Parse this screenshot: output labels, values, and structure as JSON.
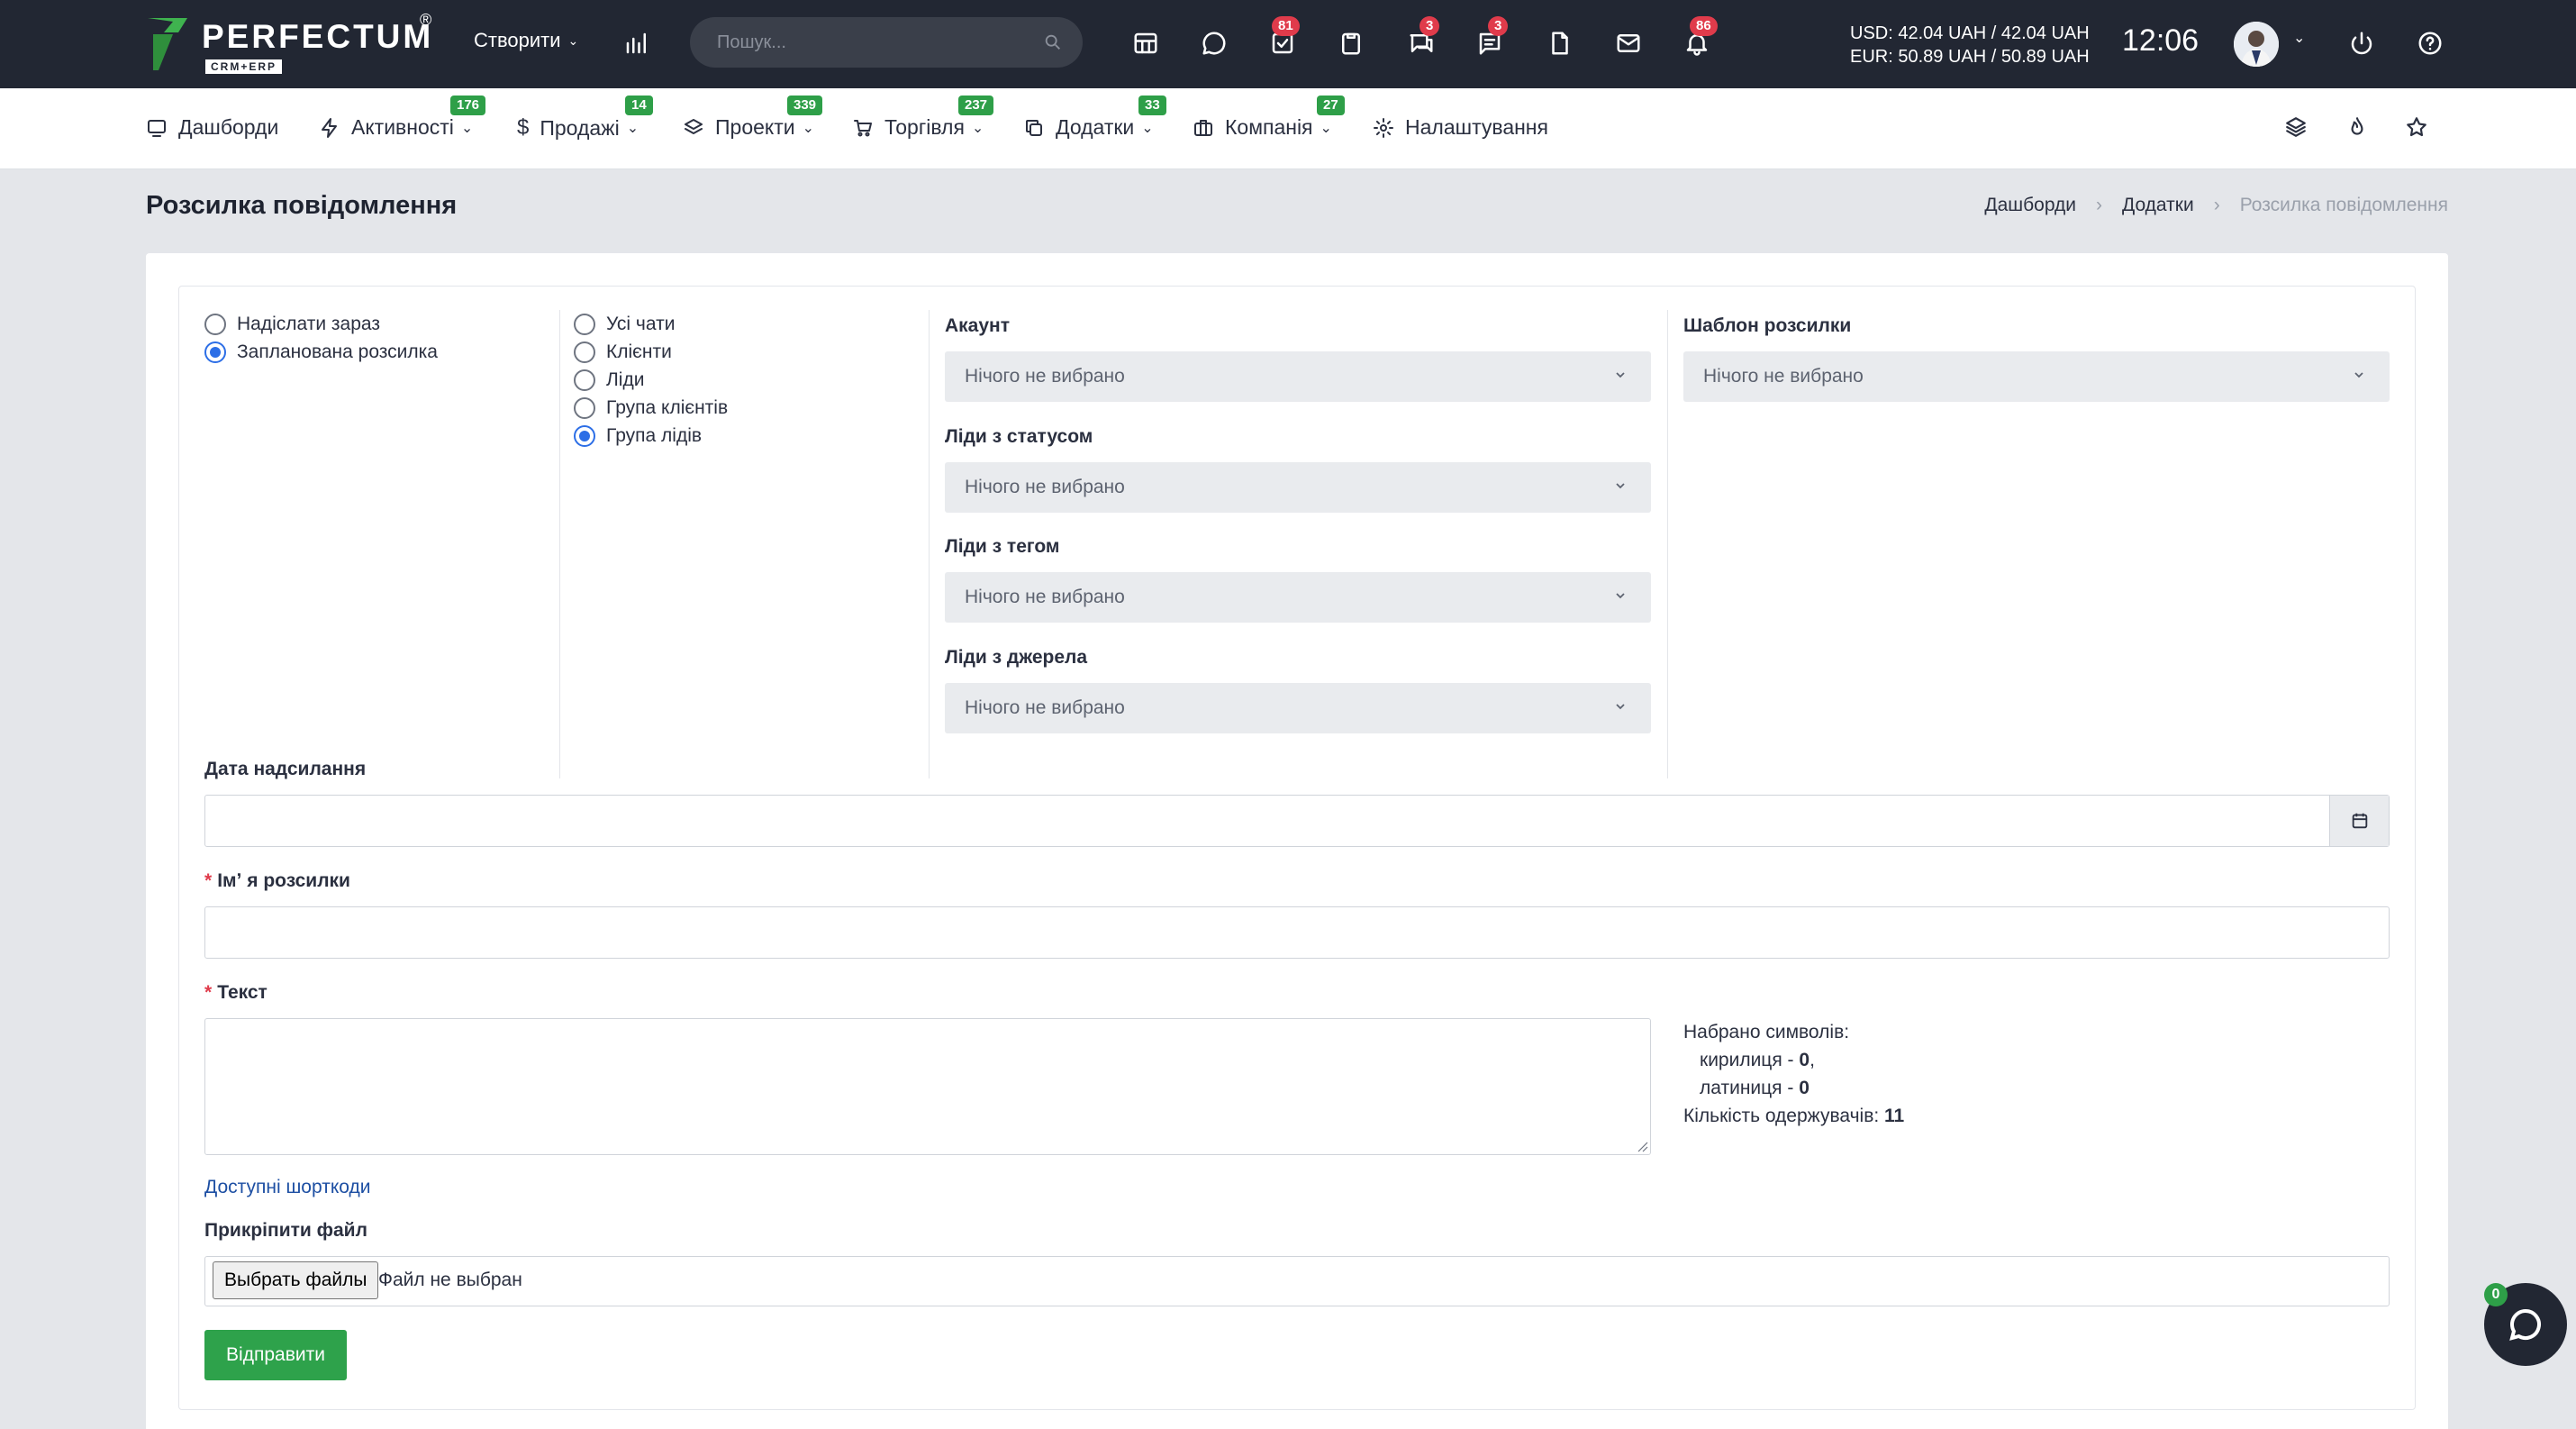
{
  "brand": {
    "name": "PERFECTUM",
    "reg": "®",
    "sub": "CRM+ERP"
  },
  "topbar": {
    "create_label": "Створити",
    "search_placeholder": "Пошук...",
    "badges": {
      "tasks": "81",
      "chat": "3",
      "messages": "3",
      "notifications": "86"
    },
    "currency_usd": "USD: 42.04 UAH / 42.04 UAH",
    "currency_eur": "EUR: 50.89 UAH / 50.89 UAH",
    "time": "12:06"
  },
  "nav": {
    "items": [
      {
        "label": "Дашборди",
        "badge": ""
      },
      {
        "label": "Активності",
        "badge": "176"
      },
      {
        "label": "Продажі",
        "badge": "14"
      },
      {
        "label": "Проекти",
        "badge": "339"
      },
      {
        "label": "Торгівля",
        "badge": "237"
      },
      {
        "label": "Додатки",
        "badge": "33"
      },
      {
        "label": "Компанія",
        "badge": "27"
      },
      {
        "label": "Налаштування",
        "badge": ""
      }
    ]
  },
  "page": {
    "title": "Розсилка повідомлення",
    "breadcrumb": [
      "Дашборди",
      "Додатки",
      "Розсилка повідомлення"
    ]
  },
  "form": {
    "send_mode": [
      "Надіслати зараз",
      "Запланована розсилка"
    ],
    "send_mode_selected": 1,
    "recipients": [
      "Усі чати",
      "Клієнти",
      "Ліди",
      "Група клієнтів",
      "Група лідів"
    ],
    "recipients_selected": 4,
    "account_label": "Акаунт",
    "leads_status_label": "Ліди з статусом",
    "leads_tag_label": "Ліди з тегом",
    "leads_source_label": "Ліди з джерела",
    "template_label": "Шаблон розсилки",
    "select_placeholder": "Нічого не вибрано",
    "date_label": "Дата надсилання",
    "name_label": "Імʼ я розсилки",
    "text_label": "Текст",
    "stats": {
      "typed_label": "Набрано символів:",
      "cyrillic_label": "кирилиця - ",
      "cyrillic_value": "0",
      "cyrillic_suffix": ",",
      "latin_label": "латиниця - ",
      "latin_value": "0",
      "recipients_label": "Кількість одержувачів: ",
      "recipients_value": "11"
    },
    "shortcodes_link": "Доступні шорткоди",
    "attach_label": "Прикріпити файл",
    "file_button": "Выбрать файлы",
    "file_none": "Файл не выбран",
    "submit": "Відправити"
  },
  "chat_widget": {
    "badge": "0"
  },
  "colors": {
    "topbar": "#222733",
    "accent_green": "#2ea24b",
    "badge_red": "#e03b4b",
    "radio_blue": "#2c6ee6",
    "link_blue": "#1d4fa3"
  }
}
